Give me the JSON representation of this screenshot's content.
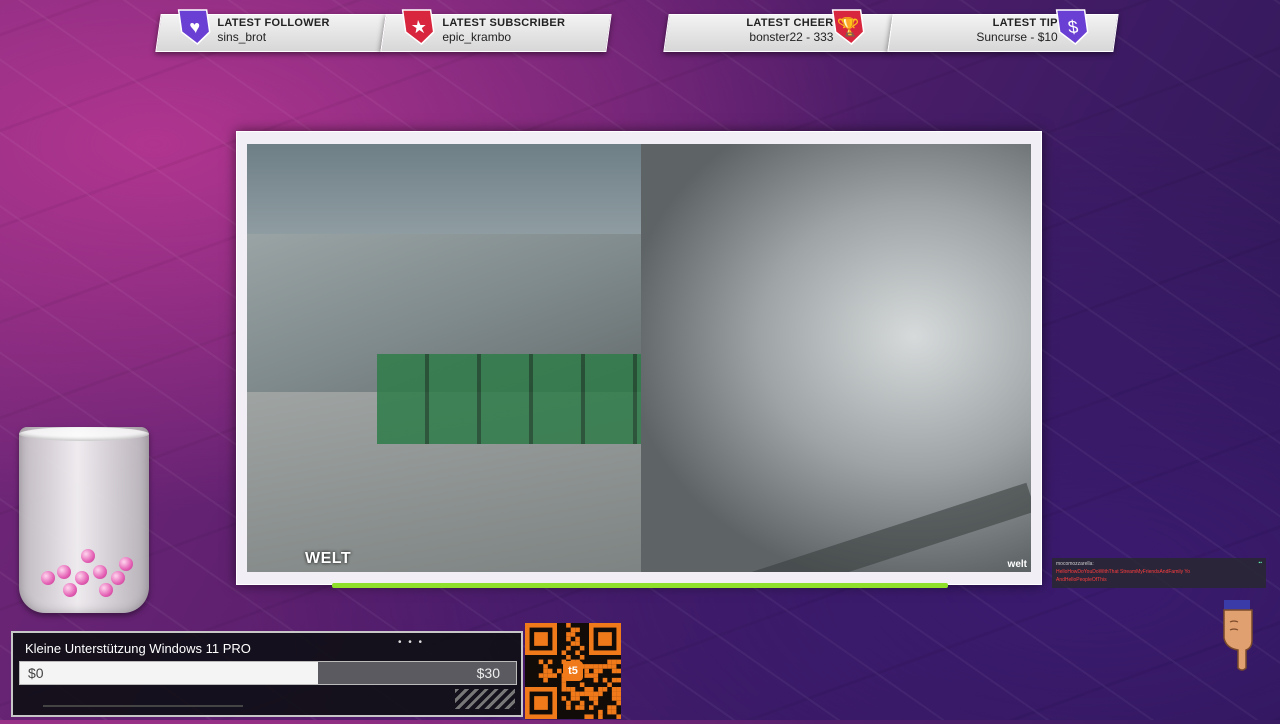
{
  "alerts": [
    {
      "title": "LATEST FOLLOWER",
      "value": "sins_brot",
      "icon": "heart-icon",
      "color": "#6a3fd3"
    },
    {
      "title": "LATEST SUBSCRIBER",
      "value": "epic_krambo",
      "icon": "star-icon",
      "color": "#d7263d"
    },
    {
      "title": "LATEST CHEER",
      "value": "bonster22 - 333",
      "icon": "trophy-icon",
      "color": "#d7263d"
    },
    {
      "title": "LATEST TIP",
      "value": "Suncurse - $10",
      "icon": "money-bag-icon",
      "color": "#6a3fd3"
    }
  ],
  "video": {
    "watermark": "WELT",
    "watermark_small": "welt",
    "progress_color": "#8ee02b"
  },
  "goal": {
    "title": "Kleine Unterstützung Windows 11 PRO",
    "start": "$0",
    "end": "$30",
    "progress": 0.6
  },
  "qr": {
    "label": "t5"
  },
  "chat": {
    "user": "mocomozzarella:",
    "message": "HelloHowDoYouDoWithThat StreamMyFriendsAndFamily Yo",
    "message2": "AndHelloPeopleOfThis"
  },
  "colors": {
    "accent_purple": "#6a3fd3",
    "accent_red": "#d7263d",
    "progress_green": "#8ee02b"
  }
}
